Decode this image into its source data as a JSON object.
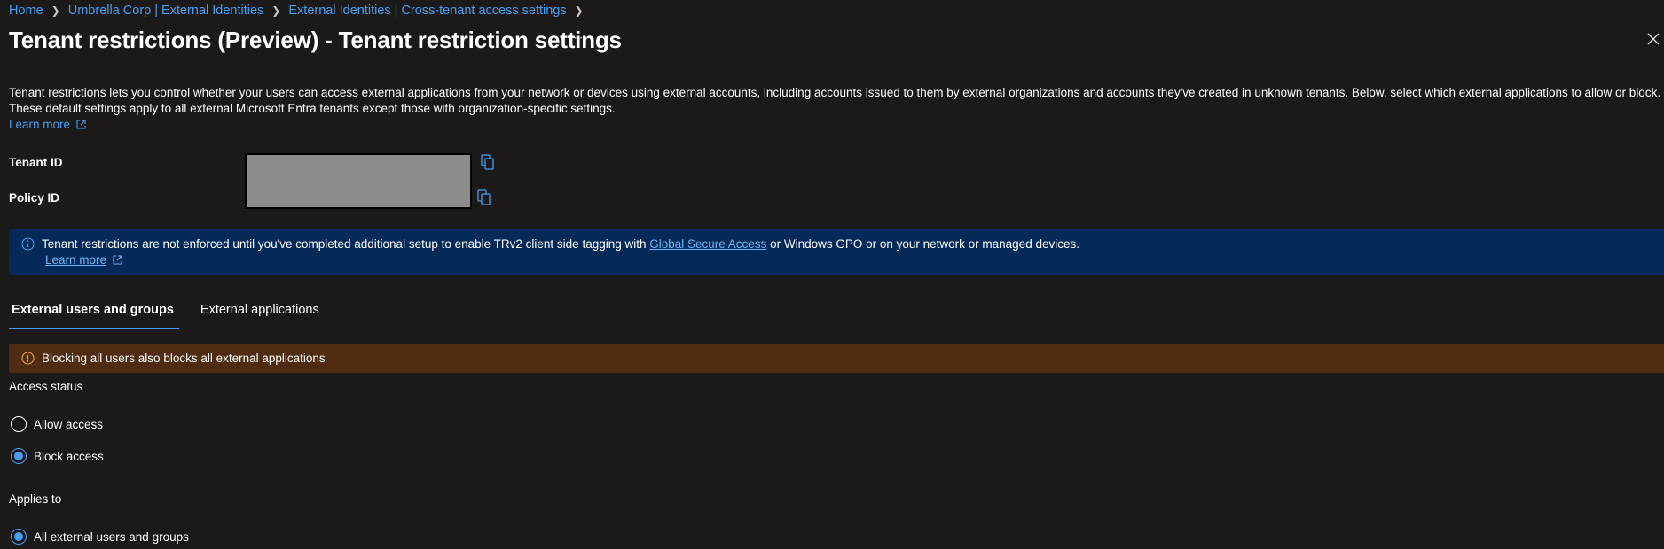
{
  "breadcrumb": {
    "items": [
      "Home",
      "Umbrella Corp | External Identities",
      "External Identities | Cross-tenant access settings"
    ],
    "separator": ">"
  },
  "page": {
    "title": "Tenant restrictions (Preview) - Tenant restriction settings",
    "more_label": "···"
  },
  "intro": {
    "text": "Tenant restrictions lets you control whether your users can access external applications from your network or devices using external accounts, including accounts issued to them by external organizations and accounts they've created in unknown tenants. Below, select which external applications to allow or block. These default settings apply to all external Microsoft Entra tenants except those with organization-specific settings.",
    "learn_more": "Learn more"
  },
  "ids": {
    "tenant_id_label": "Tenant ID",
    "policy_id_label": "Policy ID"
  },
  "info_banner": {
    "text_before": "Tenant restrictions are not enforced until you've completed additional setup to enable TRv2 client side tagging with ",
    "link": "Global Secure Access",
    "text_after": " or Windows GPO or on your network or managed devices.",
    "learn_more": "Learn more"
  },
  "tabs": [
    {
      "label": "External users and groups",
      "active": true
    },
    {
      "label": "External applications",
      "active": false
    }
  ],
  "warning_banner": {
    "text": "Blocking all users also blocks all external applications"
  },
  "access_status": {
    "label": "Access status",
    "options": [
      {
        "label": "Allow access",
        "selected": false
      },
      {
        "label": "Block access",
        "selected": true
      }
    ]
  },
  "applies_to": {
    "label": "Applies to",
    "options": [
      {
        "label": "All external users and groups",
        "selected": true
      }
    ]
  },
  "colors": {
    "background": "#1b1a19",
    "accent": "#479ef5",
    "info_banner": "#042a5a",
    "warning_banner": "#4f2c11",
    "warning_icon": "#f7a13a"
  }
}
